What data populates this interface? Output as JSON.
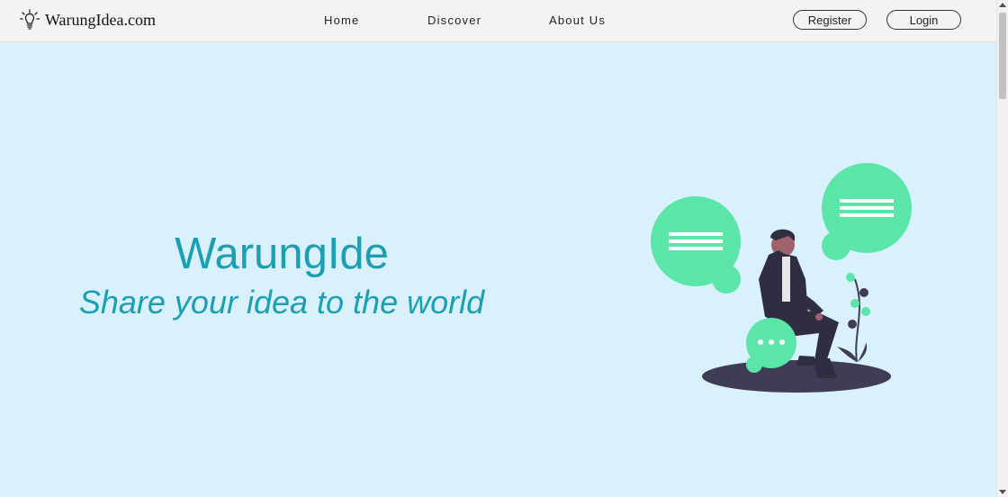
{
  "navbar": {
    "brand": {
      "icon": "lightbulb-icon",
      "name": "WarungIdea.com"
    },
    "links": [
      "Home",
      "Discover",
      "About Us"
    ],
    "register_label": "Register",
    "login_label": "Login"
  },
  "hero": {
    "title": "WarungIde",
    "tagline": "Share your idea to the world",
    "illustration": "person-with-chat-bubbles-illustration"
  },
  "colors": {
    "background": "#d9f1fd",
    "navbar": "#f4f3f2",
    "accent_text": "#1b9fb5",
    "bubble_green": "#5ce5a8",
    "figure_dark": "#2f2e41"
  }
}
